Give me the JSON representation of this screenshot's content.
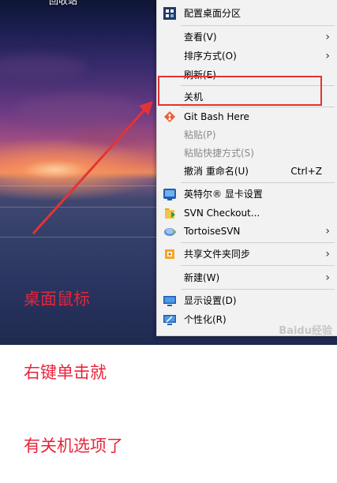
{
  "desktop": {
    "label": "回收站",
    "annotation_lines": [
      "桌面鼠标",
      "右键单击就",
      "有关机选项了"
    ]
  },
  "menu": {
    "items": [
      {
        "label": "配置桌面分区",
        "icon": "grid-icon",
        "shortcut": "",
        "arrow": false,
        "disabled": false
      },
      {
        "label": "查看(V)",
        "icon": "",
        "shortcut": "",
        "arrow": true,
        "disabled": false
      },
      {
        "label": "排序方式(O)",
        "icon": "",
        "shortcut": "",
        "arrow": true,
        "disabled": false
      },
      {
        "label": "刷新(E)",
        "icon": "",
        "shortcut": "",
        "arrow": false,
        "disabled": false
      },
      {
        "label": "关机",
        "icon": "",
        "shortcut": "",
        "arrow": false,
        "disabled": false
      },
      {
        "label": "Git Bash Here",
        "icon": "git-icon",
        "shortcut": "",
        "arrow": false,
        "disabled": false
      },
      {
        "label": "粘贴(P)",
        "icon": "",
        "shortcut": "",
        "arrow": false,
        "disabled": true
      },
      {
        "label": "粘贴快捷方式(S)",
        "icon": "",
        "shortcut": "",
        "arrow": false,
        "disabled": true
      },
      {
        "label": "撤消 重命名(U)",
        "icon": "",
        "shortcut": "Ctrl+Z",
        "arrow": false,
        "disabled": false
      },
      {
        "label": "英特尔® 显卡设置",
        "icon": "intel-graphics-icon",
        "shortcut": "",
        "arrow": false,
        "disabled": false
      },
      {
        "label": "SVN Checkout...",
        "icon": "svn-checkout-icon",
        "shortcut": "",
        "arrow": false,
        "disabled": false
      },
      {
        "label": "TortoiseSVN",
        "icon": "tortoise-icon",
        "shortcut": "",
        "arrow": true,
        "disabled": false
      },
      {
        "label": "共享文件夹同步",
        "icon": "sync-folder-icon",
        "shortcut": "",
        "arrow": true,
        "disabled": false
      },
      {
        "label": "新建(W)",
        "icon": "",
        "shortcut": "",
        "arrow": true,
        "disabled": false
      },
      {
        "label": "显示设置(D)",
        "icon": "display-icon",
        "shortcut": "",
        "arrow": false,
        "disabled": false
      },
      {
        "label": "个性化(R)",
        "icon": "personalize-icon",
        "shortcut": "",
        "arrow": false,
        "disabled": false
      }
    ]
  },
  "watermark": "Baidu经验",
  "colors": {
    "highlight": "#e53333",
    "annotation": "#e8243a",
    "menu_bg": "#f2f2f2"
  }
}
